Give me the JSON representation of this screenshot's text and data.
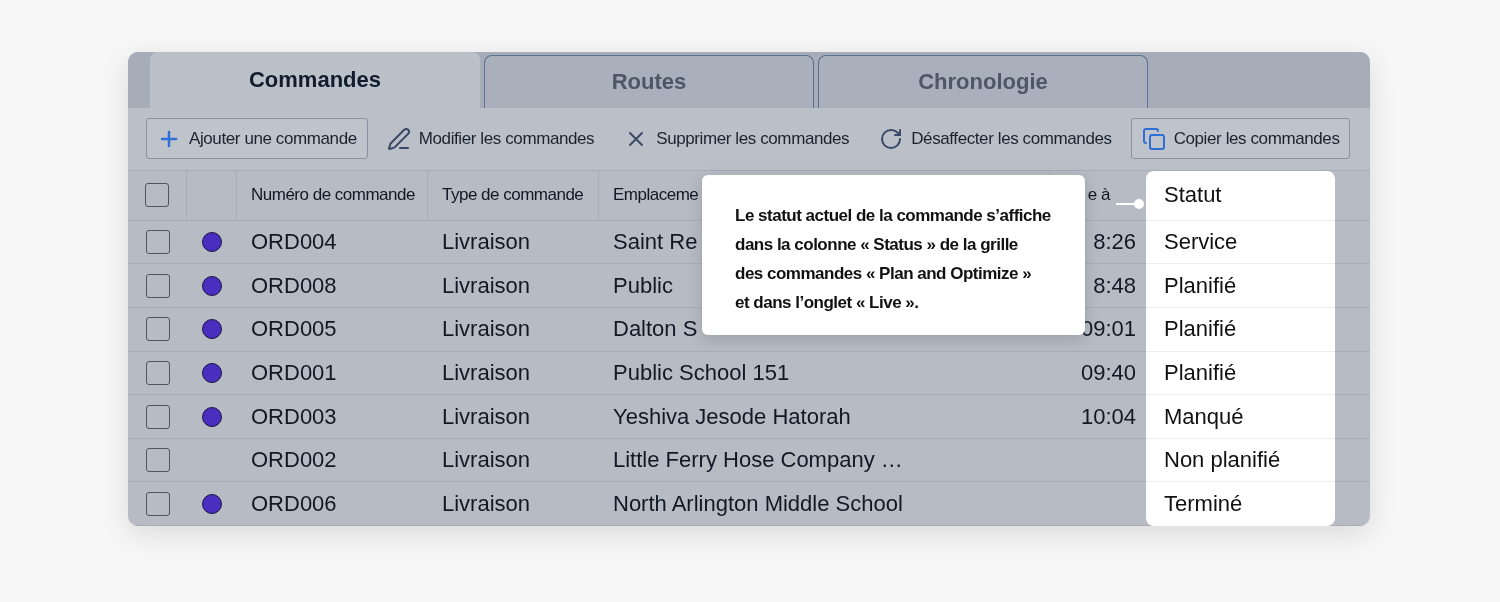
{
  "tabs": [
    {
      "label": "Commandes",
      "selected": true
    },
    {
      "label": "Routes",
      "selected": false
    },
    {
      "label": "Chronologie",
      "selected": false
    }
  ],
  "toolbar": [
    {
      "label": "Ajouter une commande",
      "kind": "plus",
      "bordered": true
    },
    {
      "label": "Modifier les commandes",
      "kind": "pencil",
      "bordered": false
    },
    {
      "label": "Supprimer les commandes",
      "kind": "x",
      "bordered": false
    },
    {
      "label": "Désaffecter les commandes",
      "kind": "rotate",
      "bordered": false
    },
    {
      "label": "Copier les commandes",
      "kind": "copy",
      "bordered": true
    }
  ],
  "table": {
    "select_all_checked": false,
    "columns": [
      "Numéro de commande",
      "Type de commande",
      "Emplaceme",
      "e à",
      "Statut"
    ],
    "rows": [
      {
        "checked": false,
        "marker": true,
        "number": "ORD004",
        "type": "Livraison",
        "location": "Saint Re",
        "time": "8:26",
        "status": "Service"
      },
      {
        "checked": false,
        "marker": true,
        "number": "ORD008",
        "type": "Livraison",
        "location": "Public",
        "time": "8:48",
        "status": "Planifié"
      },
      {
        "checked": false,
        "marker": true,
        "number": "ORD005",
        "type": "Livraison",
        "location": "Dalton S",
        "time": "09:01",
        "status": "Planifié"
      },
      {
        "checked": false,
        "marker": true,
        "number": "ORD001",
        "type": "Livraison",
        "location": "Public School 151",
        "time": "09:40",
        "status": "Planifié"
      },
      {
        "checked": false,
        "marker": true,
        "number": "ORD003",
        "type": "Livraison",
        "location": "Yeshiva Jesode Hatorah",
        "time": "10:04",
        "status": "Manqué"
      },
      {
        "checked": false,
        "marker": false,
        "number": "ORD002",
        "type": "Livraison",
        "location": "Little Ferry Hose Company …",
        "time": "",
        "status": "Non planifié"
      },
      {
        "checked": false,
        "marker": true,
        "number": "ORD006",
        "type": "Livraison",
        "location": "North Arlington Middle School",
        "time": "",
        "status": "Terminé"
      }
    ]
  },
  "callout": {
    "lines": [
      "Le statut actuel de la commande s’affiche",
      "dans la colonne « Status » de la grille",
      "des commandes « Plan and Optimize »",
      "et dans l’onglet « Live »."
    ]
  }
}
